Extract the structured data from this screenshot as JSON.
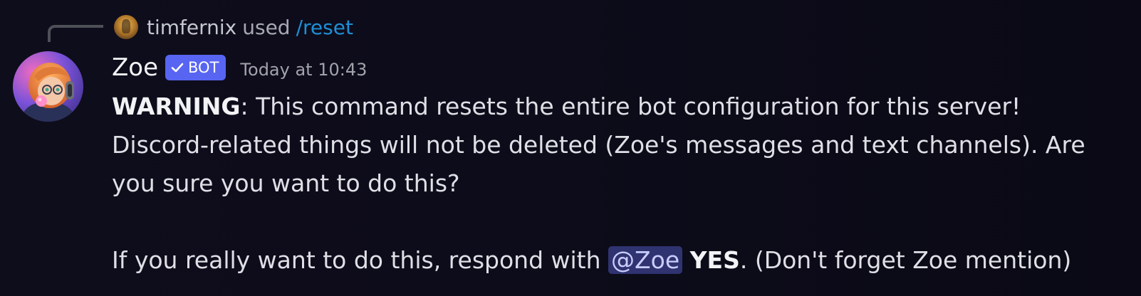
{
  "command_line": {
    "user": "timfernix",
    "used_text": "used",
    "command": "/reset"
  },
  "message": {
    "author": "Zoe",
    "bot_tag": "BOT",
    "timestamp": "Today at 10:43",
    "warning_label": "WARNING",
    "paragraph1_rest": ": This command resets the entire bot configuration for this server! Discord-related things will not be deleted (Zoe's messages and text channels). Are you sure you want to do this?",
    "paragraph2_prefix": "If you really want to do this, respond with ",
    "mention": "@Zoe",
    "paragraph2_yes": "YES",
    "paragraph2_suffix": ". (Don't forget Zoe mention)"
  },
  "colors": {
    "background": "#0d0c1a",
    "command_link": "#1e8fd6",
    "bot_tag": "#5865f2",
    "mention_bg": "#2f3370",
    "mention_text": "#c9cdfb"
  },
  "icons": {
    "mini_avatar": "user-avatar",
    "bot_check": "checkmark-icon",
    "spine": "reply-connector"
  }
}
